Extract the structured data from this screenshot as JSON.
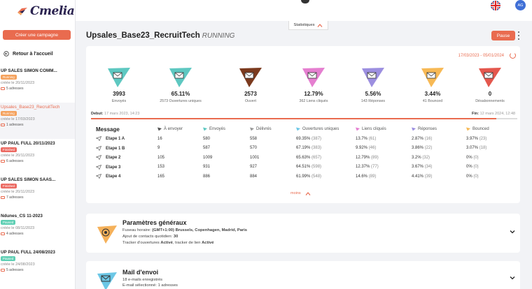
{
  "app": {
    "logo_text": "Cmelia"
  },
  "sidebar": {
    "create_label": "Créer une campagne",
    "back_label": "Retour à l'accueil",
    "campaigns": [
      {
        "name": "UP SALES SIMON COMM...",
        "badge": "Running",
        "badge_color": "#f5a25d",
        "date": "créée le 20/11/2023",
        "addresses": "5 adresses",
        "active": false
      },
      {
        "name": "Upsales_Base23_RecruitTech",
        "badge": "Running",
        "badge_color": "#f5a25d",
        "date": "créée le 17/03/2023",
        "addresses": "1 adresses",
        "active": true
      },
      {
        "name": "UP PAUL FULL 20/11/2023",
        "badge": "Finished",
        "badge_color": "#ec6a62",
        "date": "créée le 20/11/2023",
        "addresses": "6 adresses",
        "active": false
      },
      {
        "name": "UP SALES SIMON SAAS...",
        "badge": "Finished",
        "badge_color": "#ec6a62",
        "date": "créée le 20/11/2023",
        "addresses": "7 adresses",
        "active": false
      },
      {
        "name": "Ndunes_CS 11-2023",
        "badge": "Paused",
        "badge_color": "#5fcfb4",
        "date": "créée le 08/11/2023",
        "addresses": "4 adresses",
        "active": false
      },
      {
        "name": "UP PAUL FULL 24/08/2023",
        "badge": "Paused",
        "badge_color": "#5fcfb4",
        "date": "créée le 24/08/2023",
        "addresses": "5 adresses",
        "active": false
      }
    ]
  },
  "topbar": {
    "stats_tab_label": "Statistiques",
    "avatar_initials": "AG",
    "language_icon": "uk-flag-icon"
  },
  "campaign": {
    "title": "Upsales_Base23_RecruitTech",
    "status": "RUNNING",
    "pause_label": "Pause",
    "date_range": "17/03/2023 - 05/01/2024",
    "debut_label": "Debut:",
    "debut_value": "17 mars 2023, 14:23",
    "fin_label": "Fin:",
    "fin_value": "12 mars 2024, 12:48",
    "progress_fraction": 0.95,
    "more_label": "moins"
  },
  "stats": [
    {
      "value": "3993",
      "label": "Envoyés",
      "color": "#5ec8c1",
      "icon": "sent-mail-icon"
    },
    {
      "value": "65.11%",
      "label": "2573 Ouvertures uniques",
      "color": "#5ec8c1",
      "icon": "open-mail-icon"
    },
    {
      "value": "2573",
      "label": "Ouvert",
      "color": "#7b3a1e",
      "icon": "opened-envelope-icon"
    },
    {
      "value": "12.79%",
      "label": "362 Liens cliqués",
      "color": "#e57fd0",
      "icon": "link-click-icon"
    },
    {
      "value": "5.56%",
      "label": "143 Réponses",
      "color": "#9c8fe0",
      "icon": "reply-icon"
    },
    {
      "value": "3.44%",
      "label": "41 Bounced",
      "color": "#f7b955",
      "icon": "bounce-icon"
    },
    {
      "value": "0",
      "label": "Désabonnements",
      "color": "#e4574d",
      "icon": "unsubscribe-icon"
    }
  ],
  "table": {
    "columns": [
      {
        "label": "Message",
        "color": ""
      },
      {
        "label": "À envoyer",
        "color": "#555555"
      },
      {
        "label": "Envoyés",
        "color": "#5ec8c1"
      },
      {
        "label": "Délivrés",
        "color": "#999999"
      },
      {
        "label": "Ouvertures uniques",
        "color": "#6cc7e6"
      },
      {
        "label": "Liens cliqués",
        "color": "#e57fd0"
      },
      {
        "label": "Réponses",
        "color": "#9c8fe0"
      },
      {
        "label": "Bounced",
        "color": "#f7b955"
      }
    ],
    "rows": [
      {
        "step": "Etape 1 A",
        "to_send": "16",
        "sent": "580",
        "delivered": "558",
        "opens": "69.35%",
        "opens_n": "(387)",
        "clicks": "13.7%",
        "clicks_n": "(61)",
        "replies": "2.87%",
        "replies_n": "(16)",
        "bounced": "3.97%",
        "bounced_n": "(23)"
      },
      {
        "step": "Etape 1 B",
        "to_send": "9",
        "sent": "587",
        "delivered": "570",
        "opens": "67.19%",
        "opens_n": "(383)",
        "clicks": "9.92%",
        "clicks_n": "(46)",
        "replies": "3.86%",
        "replies_n": "(22)",
        "bounced": "3.07%",
        "bounced_n": "(18)"
      },
      {
        "step": "Etape 2",
        "to_send": "105",
        "sent": "1009",
        "delivered": "1001",
        "opens": "65.63%",
        "opens_n": "(657)",
        "clicks": "12.79%",
        "clicks_n": "(89)",
        "replies": "3.2%",
        "replies_n": "(32)",
        "bounced": "0%",
        "bounced_n": "(0)"
      },
      {
        "step": "Etape 3",
        "to_send": "153",
        "sent": "931",
        "delivered": "927",
        "opens": "64.51%",
        "opens_n": "(598)",
        "clicks": "12.37%",
        "clicks_n": "(77)",
        "replies": "3.67%",
        "replies_n": "(34)",
        "bounced": "0%",
        "bounced_n": "(0)"
      },
      {
        "step": "Etape 4",
        "to_send": "165",
        "sent": "886",
        "delivered": "884",
        "opens": "61.99%",
        "opens_n": "(548)",
        "clicks": "14.6%",
        "clicks_n": "(89)",
        "replies": "4.41%",
        "replies_n": "(39)",
        "bounced": "0%",
        "bounced_n": "(0)"
      }
    ]
  },
  "general_settings": {
    "title": "Paramètres généraux",
    "timezone_label": "Fuseau horaire:",
    "timezone_value": "(GMT+1:00) Brussels, Copenhagen, Madrid, Paris",
    "daily_label": "Ajout de contacts quotidien:",
    "daily_value": "30",
    "tracker_label": "Tracker d'ouvertures",
    "tracker_value": "Activé",
    "link_tracker_label": ", tracker de lien",
    "link_tracker_value": "Activé"
  },
  "mail_section": {
    "title": "Mail d'envoi",
    "emails_count": "18 e-mails enregistrés",
    "selected": "E-mail sélectionné: 1 adresses"
  }
}
